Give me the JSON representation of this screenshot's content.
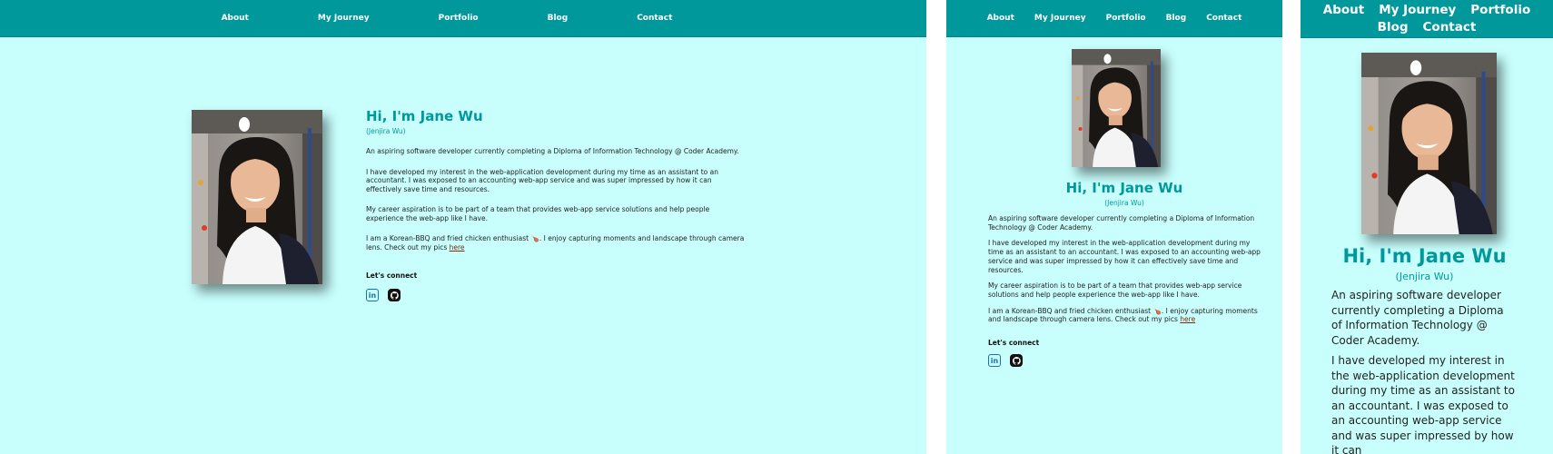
{
  "nav": {
    "items": [
      "About",
      "My Journey",
      "Portfolio",
      "Blog",
      "Contact"
    ]
  },
  "profile": {
    "greeting": "Hi, I'm Jane Wu",
    "alt_name": "(Jenjira Wu)",
    "intro": "An aspiring software developer currently completing a Diploma of Information Technology @ Coder Academy.",
    "interest": "I have developed my interest in the web-application development during my time as an assistant to an accountant. I was exposed to an accounting web-app service and was super impressed by how it can effectively save time and resources.",
    "aspiration": "My career aspiration is to be part of a team that provides web-app service solutions and help people experience the web-app like I have.",
    "hobbies_prefix": "I am a Korean-BBQ and fried chicken enthusiast 🍗. I enjoy capturing moments and landscape through camera lens. Check out my pics ",
    "hobbies_link": "here",
    "connect_label": "Let's connect",
    "social_icons": [
      "linkedin-icon",
      "github-icon"
    ]
  },
  "mobile_visible": {
    "interest": "I have developed my interest in the web-application development during my time as an assistant to an accountant. I was exposed to an accounting web-app service and was super impressed by how it can"
  },
  "colors": {
    "nav_bg": "#00989b",
    "page_bg": "#c8fffd",
    "heading": "#00989b",
    "link": "#7a2a10"
  }
}
